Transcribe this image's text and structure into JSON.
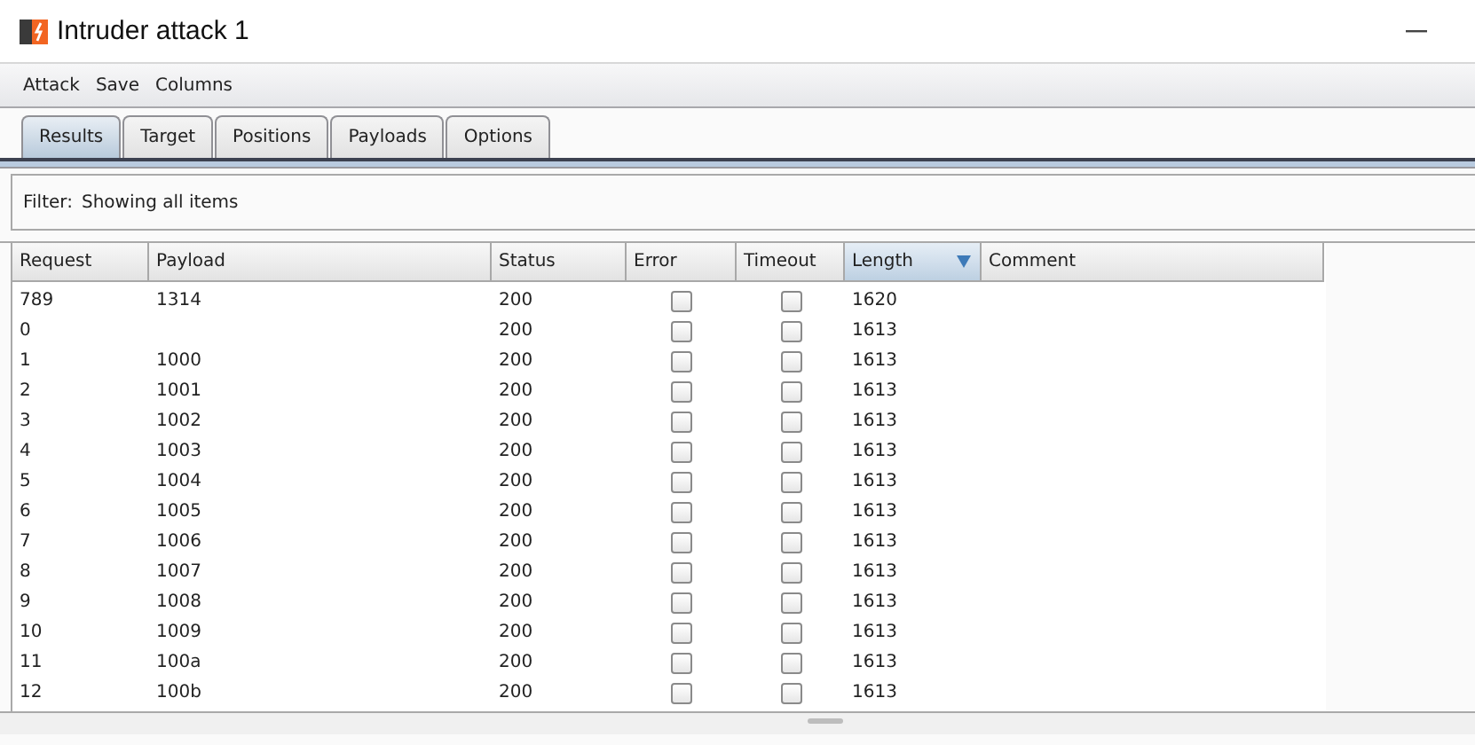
{
  "window": {
    "title": "Intruder attack 1"
  },
  "menu": [
    "Attack",
    "Save",
    "Columns"
  ],
  "tabs": [
    {
      "label": "Results",
      "selected": true
    },
    {
      "label": "Target",
      "selected": false
    },
    {
      "label": "Positions",
      "selected": false
    },
    {
      "label": "Payloads",
      "selected": false
    },
    {
      "label": "Options",
      "selected": false
    }
  ],
  "filter": {
    "label": "Filter:",
    "text": "Showing all items"
  },
  "table": {
    "columns": [
      {
        "label": "Request",
        "sorted": false
      },
      {
        "label": "Payload",
        "sorted": false
      },
      {
        "label": "Status",
        "sorted": false
      },
      {
        "label": "Error",
        "sorted": false
      },
      {
        "label": "Timeout",
        "sorted": false
      },
      {
        "label": "Length",
        "sorted": true
      },
      {
        "label": "Comment",
        "sorted": false
      }
    ],
    "rows": [
      {
        "request": "789",
        "payload": "1314",
        "status": "200",
        "error": false,
        "timeout": false,
        "length": "1620"
      },
      {
        "request": "0",
        "payload": "",
        "status": "200",
        "error": false,
        "timeout": false,
        "length": "1613"
      },
      {
        "request": "1",
        "payload": "1000",
        "status": "200",
        "error": false,
        "timeout": false,
        "length": "1613"
      },
      {
        "request": "2",
        "payload": "1001",
        "status": "200",
        "error": false,
        "timeout": false,
        "length": "1613"
      },
      {
        "request": "3",
        "payload": "1002",
        "status": "200",
        "error": false,
        "timeout": false,
        "length": "1613"
      },
      {
        "request": "4",
        "payload": "1003",
        "status": "200",
        "error": false,
        "timeout": false,
        "length": "1613"
      },
      {
        "request": "5",
        "payload": "1004",
        "status": "200",
        "error": false,
        "timeout": false,
        "length": "1613"
      },
      {
        "request": "6",
        "payload": "1005",
        "status": "200",
        "error": false,
        "timeout": false,
        "length": "1613"
      },
      {
        "request": "7",
        "payload": "1006",
        "status": "200",
        "error": false,
        "timeout": false,
        "length": "1613"
      },
      {
        "request": "8",
        "payload": "1007",
        "status": "200",
        "error": false,
        "timeout": false,
        "length": "1613"
      },
      {
        "request": "9",
        "payload": "1008",
        "status": "200",
        "error": false,
        "timeout": false,
        "length": "1613"
      },
      {
        "request": "10",
        "payload": "1009",
        "status": "200",
        "error": false,
        "timeout": false,
        "length": "1613"
      },
      {
        "request": "11",
        "payload": "100a",
        "status": "200",
        "error": false,
        "timeout": false,
        "length": "1613"
      },
      {
        "request": "12",
        "payload": "100b",
        "status": "200",
        "error": false,
        "timeout": false,
        "length": "1613"
      }
    ]
  }
}
